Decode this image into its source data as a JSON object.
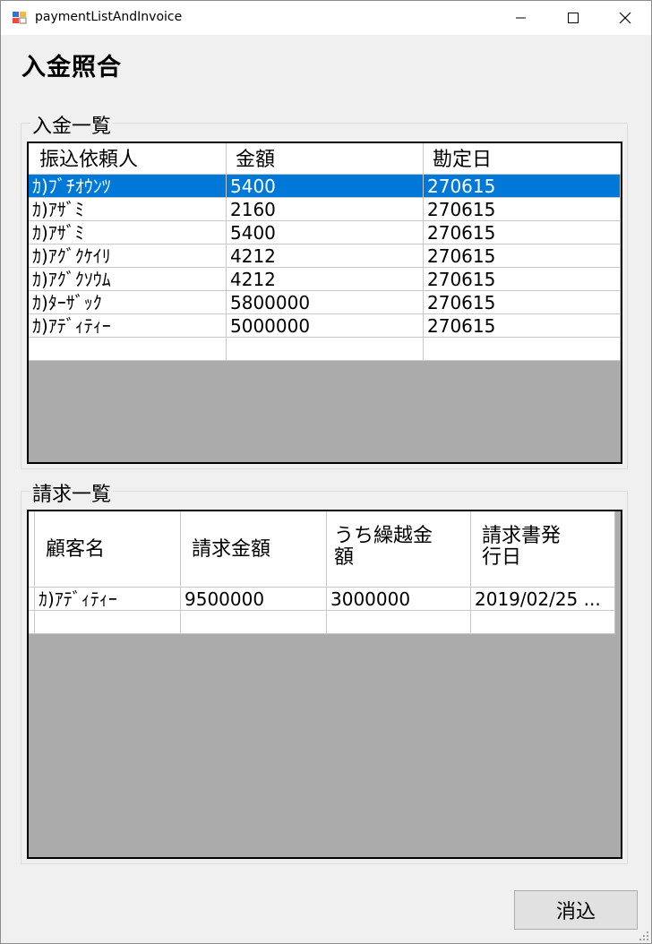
{
  "window": {
    "title": "paymentListAndInvoice"
  },
  "page_title": "入金照合",
  "payments": {
    "legend": "入金一覧",
    "columns": [
      "振込依頼人",
      "金額",
      "勘定日"
    ],
    "rows": [
      [
        "ｶ)ﾌﾞﾁｵｳﾝﾂ",
        "5400",
        "270615"
      ],
      [
        "ｶ)ｱｻﾞﾐ",
        "2160",
        "270615"
      ],
      [
        "ｶ)ｱｻﾞﾐ",
        "5400",
        "270615"
      ],
      [
        "ｶ)ｱｸﾞｸｹｲﾘ",
        "4212",
        "270615"
      ],
      [
        "ｶ)ｱｸﾞｸｿｳﾑ",
        "4212",
        "270615"
      ],
      [
        "ｶ)ﾀｰｻﾞｯｸ",
        "5800000",
        "270615"
      ],
      [
        "ｶ)ｱﾃﾞｨﾃｨｰ",
        "5000000",
        "270615"
      ]
    ]
  },
  "invoices": {
    "legend": "請求一覧",
    "columns": [
      "顧客名",
      "請求金額",
      "うち繰越金額",
      "請求書発行日"
    ],
    "column_lines": [
      [
        "顧客名"
      ],
      [
        "請求金額"
      ],
      [
        "うち繰越金",
        "額"
      ],
      [
        "請求書発",
        "行日"
      ]
    ],
    "rows": [
      [
        "ｶ)ｱﾃﾞｨﾃｨｰ",
        "9500000",
        "3000000",
        "2019/02/25 ..."
      ]
    ]
  },
  "apply_button": "消込",
  "colors": {
    "selection": "#0078d7",
    "grid_bg": "#ababab",
    "window_bg": "#f0f0f0"
  }
}
